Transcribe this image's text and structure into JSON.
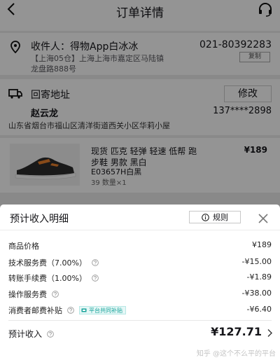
{
  "nav": {
    "title": "订单详情"
  },
  "address": {
    "name": "收件人：得物App白冰冰",
    "phone": "021-80392283",
    "line1": "【上海05仓】上海上海市嘉定区马陆镇",
    "line2": "龙盘路888号",
    "copy_label": "复制"
  },
  "return": {
    "title": "回寄地址",
    "modify_label": "修改",
    "name": "赵云龙",
    "phone": "137****2898",
    "address": "山东省烟台市福山区清洋街道西关小区华莉小屋"
  },
  "product": {
    "title_line1": "现货 匹克 轻弹 轻速 低帮 跑",
    "title_line2": "步鞋 男款 黑白",
    "price": "¥189",
    "sku": "E03657H白黑",
    "size_qty": "39 数量×1"
  },
  "sheet": {
    "title": "预计收入明细",
    "rules_label": "规则",
    "rows": [
      {
        "label": "商品价格",
        "value": "¥189",
        "help": false
      },
      {
        "label": "技术服务费（7.00%）",
        "value": "-¥15.00",
        "help": true
      },
      {
        "label": "转账手续费（1.00%）",
        "value": "-¥1.89",
        "help": true
      },
      {
        "label": "操作服务费",
        "value": "-¥38.00",
        "help": true
      },
      {
        "label": "消费者邮费补贴",
        "value": "-¥6.40",
        "help": true,
        "tag": "平台共同补贴"
      }
    ],
    "total_label": "预计收入",
    "total_value": "¥127.71"
  },
  "watermark": "知乎 @这个不么平的平台",
  "colors": {
    "accent_teal": "#16a39a",
    "overlay": "#000000"
  }
}
